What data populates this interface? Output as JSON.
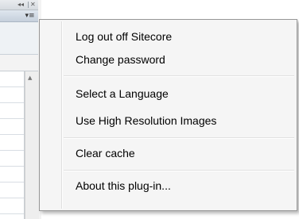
{
  "titlebar": {
    "back_glyph": "◂◂",
    "close_glyph": "✕"
  },
  "toolbar": {
    "menu_glyph": "▾≡"
  },
  "scroll": {
    "up_glyph": "▲"
  },
  "menu": {
    "items": [
      {
        "label": "Log out off Sitecore"
      },
      {
        "label": "Change password"
      },
      {
        "label": "Select a Language"
      },
      {
        "label": "Use High Resolution Images"
      },
      {
        "label": "Clear cache"
      },
      {
        "label": "About this plug-in..."
      }
    ]
  },
  "icons": {
    "collapse": "double-left-arrow-icon",
    "close": "close-icon",
    "menu": "menu-dropdown-icon",
    "scroll_up": "scroll-up-arrow-icon"
  }
}
